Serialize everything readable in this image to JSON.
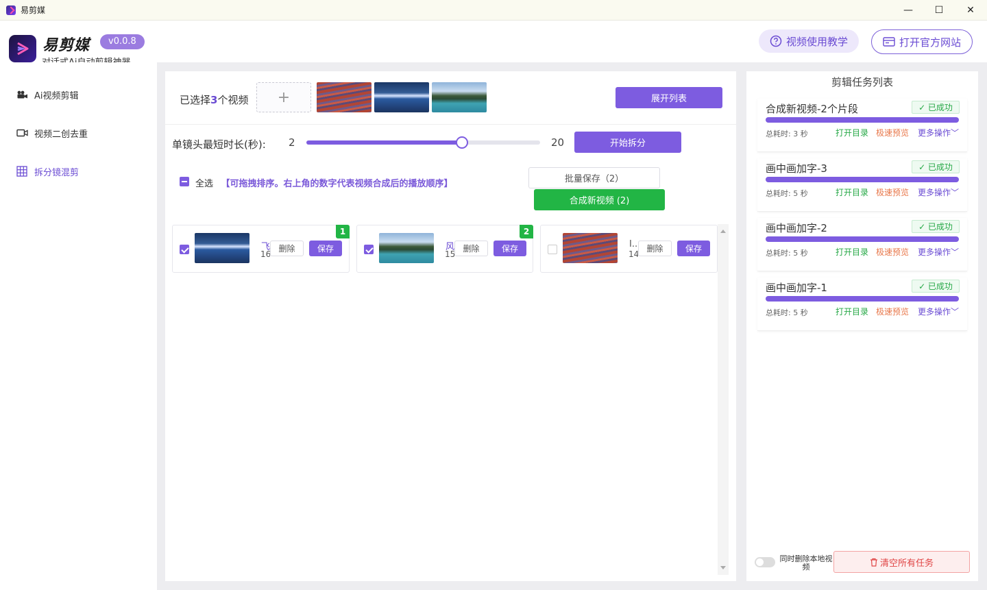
{
  "window": {
    "title": "易剪媒",
    "minimize": "—",
    "maximize": "☐",
    "close": "✕"
  },
  "header": {
    "brand": "易剪媒",
    "version": "v0.0.8",
    "slogan": "对话式Ai自动剪辑神器",
    "tutorial_button": "视频使用教学",
    "website_button": "打开官方网站"
  },
  "sidebar": {
    "items": [
      {
        "label": "Ai视频剪辑",
        "icon": "video-camera-icon",
        "active": false
      },
      {
        "label": "视频二创去重",
        "icon": "video-icon",
        "active": false
      },
      {
        "label": "拆分镜混剪",
        "icon": "grid-icon",
        "active": true
      }
    ]
  },
  "main": {
    "selected_prefix": "已选择",
    "selected_count": "3",
    "selected_suffix": "个视频",
    "add_symbol": "+",
    "expand_button": "展开列表",
    "duration_label": "单镜头最短时长(秒):",
    "duration_min": "2",
    "duration_max": "20",
    "duration_value": 14,
    "split_button": "开始拆分",
    "select_all": "全选",
    "hint": "【可拖拽排序。右上角的数字代表视频合成后的播放顺序】",
    "batch_save": "批量保存（2）",
    "compose_button": "合成新视频 (2)",
    "clips": [
      {
        "name": "飞",
        "duration": "16",
        "checked": true,
        "order": "1",
        "thumb": "blue",
        "delete": "删除",
        "save": "保存"
      },
      {
        "name": "风",
        "duration": "15",
        "checked": true,
        "order": "2",
        "thumb": "lake",
        "delete": "删除",
        "save": "保存"
      },
      {
        "name": "I..",
        "duration": "14",
        "checked": false,
        "order": "",
        "thumb": "red",
        "delete": "删除",
        "save": "保存"
      }
    ]
  },
  "tasks": {
    "title": "剪辑任务列表",
    "items": [
      {
        "name": "合成新视频-2个片段",
        "status": "✓ 已成功",
        "time": "总耗时: 3 秒",
        "open": "打开目录",
        "preview": "极速预览",
        "more": "更多操作﹀"
      },
      {
        "name": "画中画加字-3",
        "status": "✓ 已成功",
        "time": "总耗时: 5 秒",
        "open": "打开目录",
        "preview": "极速预览",
        "more": "更多操作﹀"
      },
      {
        "name": "画中画加字-2",
        "status": "✓ 已成功",
        "time": "总耗时: 5 秒",
        "open": "打开目录",
        "preview": "极速预览",
        "more": "更多操作﹀"
      },
      {
        "name": "画中画加字-1",
        "status": "✓ 已成功",
        "time": "总耗时: 5 秒",
        "open": "打开目录",
        "preview": "极速预览",
        "more": "更多操作﹀"
      }
    ],
    "toggle_label": "同时删除本地视频",
    "clear_button": "清空所有任务"
  },
  "colors": {
    "accent": "#7d5ce0",
    "success": "#22b545",
    "danger": "#e04444"
  }
}
